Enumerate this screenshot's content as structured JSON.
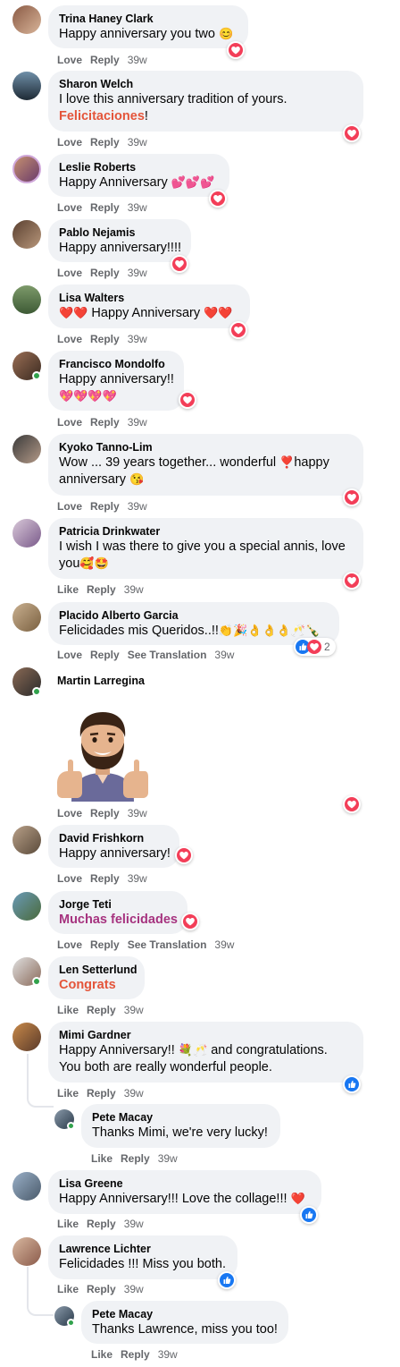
{
  "labels": {
    "love": "Love",
    "like": "Like",
    "reply": "Reply",
    "see_translation": "See Translation"
  },
  "comments": [
    {
      "name": "Trina Haney Clark",
      "text": "Happy anniversary you two",
      "emoji": "😊",
      "time": "39w"
    },
    {
      "name": "Sharon Welch",
      "text": "I love this anniversary tradition of yours.",
      "text2": "Felicitaciones",
      "text2_suffix": "!",
      "time": "39w"
    },
    {
      "name": "Leslie Roberts",
      "text": "Happy Anniversary",
      "emoji": "💕💕💕",
      "time": "39w"
    },
    {
      "name": "Pablo Nejamis",
      "text": "Happy anniversary!!!!",
      "time": "39w"
    },
    {
      "name": "Lisa Walters",
      "emoji_before": "❤️❤️",
      "text": "Happy Anniversary",
      "emoji": "❤️❤️",
      "time": "39w"
    },
    {
      "name": "Francisco Mondolfo",
      "text": "Happy anniversary!!",
      "text2": "💖💖💖💖",
      "time": "39w"
    },
    {
      "name": "Kyoko Tanno-Lim",
      "text": "Wow ... 39 years together... wonderful",
      "emoji": "❣️",
      "text_tail": "happy",
      "text2": "anniversary",
      "emoji2": "😘",
      "time": "39w"
    },
    {
      "name": "Patricia Drinkwater",
      "text": "I wish I was there to give you a special annis, love",
      "text2": "you",
      "emoji2": "🥰🤩",
      "time": "39w"
    },
    {
      "name": "Placido Alberto Garcia",
      "text": "Felicidades mis Queridos..!!",
      "emoji": "👏🎉👌👌👌🥂🍾",
      "reaction_count": "2",
      "time": "39w"
    },
    {
      "name": "Martin Larregina",
      "sticker": "avatar-thumbs-up-sticker",
      "time": "39w"
    },
    {
      "name": "David Frishkorn",
      "text": "Happy anniversary!",
      "time": "39w"
    },
    {
      "name": "Jorge Teti",
      "text": "Muchas felicidades",
      "time": "39w"
    },
    {
      "name": "Len Setterlund",
      "text": "Congrats",
      "time": "39w"
    },
    {
      "name": "Mimi Gardner",
      "text": "Happy Anniversary!!",
      "emoji": "💐🥂",
      "text_tail": "and congratulations.",
      "text2": "You both are really wonderful people.",
      "time": "39w"
    },
    {
      "name": "Pete Macay",
      "text": "Thanks Mimi, we're very lucky!",
      "time": "39w"
    },
    {
      "name": "Lisa Greene",
      "text": "Happy Anniversary!!! Love the collage!!!",
      "emoji": "❤️",
      "time": "39w"
    },
    {
      "name": "Lawrence Lichter",
      "text": "Felicidades !!! Miss you both.",
      "time": "39w"
    },
    {
      "name": "Pete Macay",
      "text": "Thanks Lawrence, miss you too!",
      "time": "39w"
    }
  ],
  "colors": {
    "bubble": "#f0f2f5",
    "love": "#f33e58",
    "like": "#1877f2",
    "meta": "#65676b",
    "highlight_red": "#e4553a",
    "highlight_purple": "#a6337f"
  }
}
